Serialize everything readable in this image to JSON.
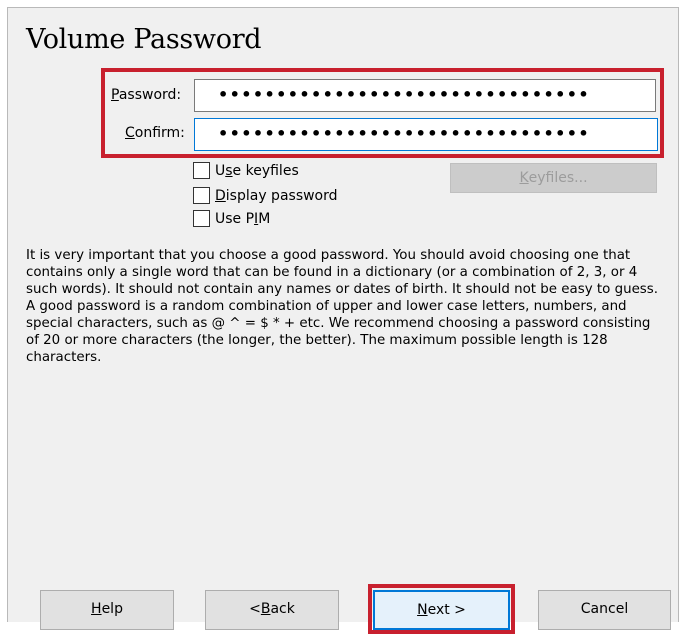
{
  "dialog": {
    "title": "Volume Password"
  },
  "password": {
    "label_acc": "P",
    "label_rest": "assword:",
    "value": "••••••••••••••••••••••••••••••••"
  },
  "confirm": {
    "label_acc": "C",
    "label_rest": "onfirm:",
    "value": "••••••••••••••••••••••••••••••••"
  },
  "options": {
    "use_keyfiles": {
      "pre": "U",
      "acc": "s",
      "post": "e keyfiles",
      "checked": false
    },
    "display_password": {
      "pre": "",
      "acc": "D",
      "post": "isplay password",
      "checked": false
    },
    "use_pim": {
      "pre": "Use P",
      "acc": "I",
      "post": "M",
      "checked": false
    }
  },
  "keyfiles_button": {
    "acc": "K",
    "rest": "eyfiles..."
  },
  "info_text": "It is very important that you choose a good password. You should avoid choosing one that contains only a single word that can be found in a dictionary (or a combination of 2, 3, or 4 such words). It should not contain any names or dates of birth. It should not be easy to guess. A good password is a random combination of upper and lower case letters, numbers, and special characters, such as @ ^ = $ * + etc. We recommend choosing a password consisting of 20 or more characters (the longer, the better). The maximum possible length is 128 characters.",
  "buttons": {
    "help": {
      "acc": "H",
      "rest": "elp"
    },
    "back": {
      "pre": "< ",
      "acc": "B",
      "rest": "ack"
    },
    "next": {
      "acc": "N",
      "rest": "ext >"
    },
    "cancel": {
      "label": "Cancel"
    }
  },
  "colors": {
    "highlight": "#c8202e",
    "focus": "#0078d7",
    "dialog_bg": "#f0f0f0"
  }
}
